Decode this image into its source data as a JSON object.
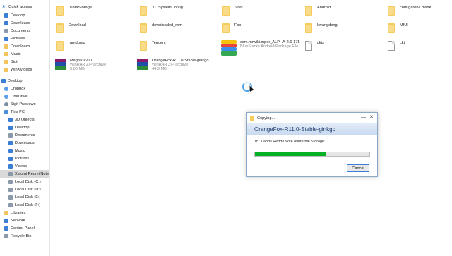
{
  "nav": {
    "quick_access": "Quick access",
    "items": [
      "Desktop",
      "Downloads",
      "Documents",
      "Pictures",
      "Downloads",
      "Music",
      "Sigit",
      "WinXVideos",
      "Desktop",
      "Dropbox",
      "OneDrive",
      "Sigit Prastowo",
      "This PC",
      "3D Objects",
      "Desktop",
      "Documents",
      "Downloads",
      "Music",
      "Pictures",
      "Videos",
      "Xiaomi Redmi Note",
      "Local Disk (C:)",
      "Local Disk (D:)",
      "Local Disk (E:)",
      "Local Disk (F:)",
      "Libraries",
      "Network",
      "Control Panel",
      "Recycle Bin"
    ]
  },
  "files": [
    {
      "name": ".DataStorage",
      "type": "folder"
    },
    {
      "name": ".UTSystemConfig",
      "type": "folder"
    },
    {
      "name": ".vivo",
      "type": "folder"
    },
    {
      "name": "Android",
      "type": "folder"
    },
    {
      "name": "com.garena.msdk",
      "type": "folder"
    },
    {
      "name": "Download",
      "type": "folder"
    },
    {
      "name": "downloaded_rom",
      "type": "folder"
    },
    {
      "name": "Fox",
      "type": "folder"
    },
    {
      "name": "kwangdong",
      "type": "folder"
    },
    {
      "name": "MIUI",
      "type": "folder"
    },
    {
      "name": "ramdump",
      "type": "folder"
    },
    {
      "name": "Tencent",
      "type": "folder"
    },
    {
      "name": "com.mrwiki.mper_ALPHA-2.6-175",
      "sub": "BlueStacks Android Package File",
      "type": "apk"
    },
    {
      "name": "ckts",
      "type": "doc"
    },
    {
      "name": "ckt",
      "type": "doc"
    },
    {
      "name": "Magisk-v21.0",
      "sub1": "WinRAR ZIP archive",
      "sub2": "5.80 MB",
      "type": "rar"
    },
    {
      "name": "OrangeFox-R11.0-Stable-ginkgo",
      "sub1": "WinRAR ZIP archive",
      "sub2": "44.3 MB",
      "type": "rar"
    }
  ],
  "dialog": {
    "title": "Copying...",
    "minimize": "—",
    "close": "✕",
    "filename": "OrangeFox-R11.0-Stable-ginkgo",
    "destination": "To 'Xiaomi Redmi Note 8\\Internal Storage'",
    "progress": 0.62,
    "cancel": "Cancel"
  },
  "colors": {
    "progress": "#06b025",
    "folder": "#f5cb5c",
    "dialog_band": "#c7d8ef"
  }
}
